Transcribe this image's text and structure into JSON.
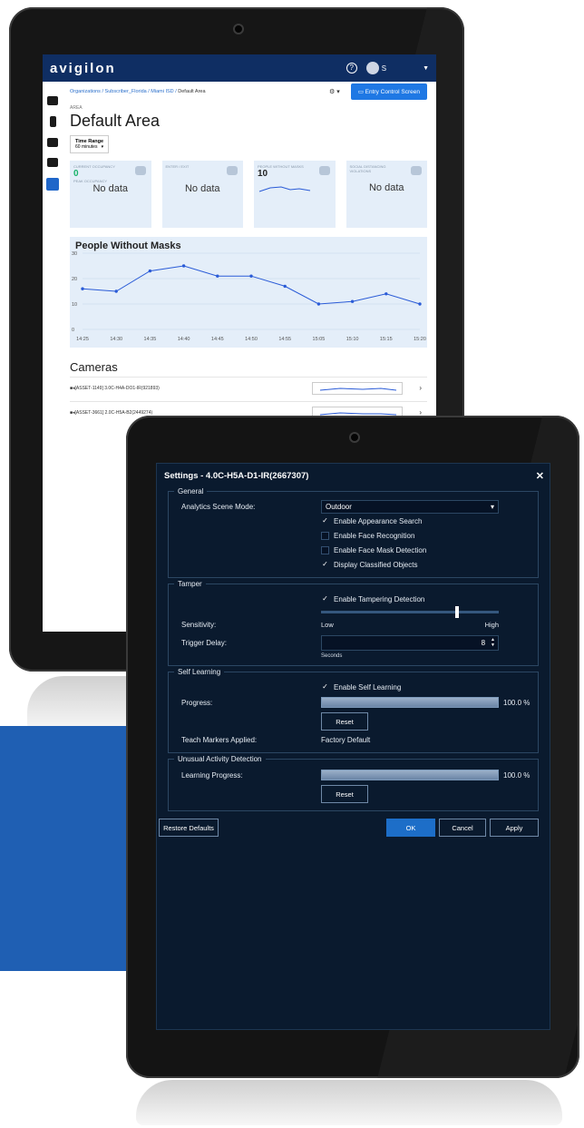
{
  "back_app": {
    "logo": "avigilon",
    "user_initial": "S",
    "breadcrumb": {
      "org": "Organizations",
      "sub": "Subscriber_Florida",
      "site": "Miami ISD",
      "current": "Default Area",
      "sep": "/"
    },
    "entry_button": "Entry Control Screen",
    "area_label": "AREA",
    "title": "Default Area",
    "time_range": {
      "label": "Time Range",
      "value": "60 minutes"
    },
    "cards": {
      "occupancy": {
        "label": "CURRENT OCCUPANCY",
        "value": "0",
        "peak_label": "PEAK OCCUPANCY",
        "peak_value": "No data"
      },
      "enter_exit": {
        "label": "ENTER / EXIT",
        "value": "No data"
      },
      "no_masks": {
        "label": "PEOPLE WITHOUT MASKS",
        "value": "10"
      },
      "social": {
        "label": "SOCIAL DISTANCING VIOLATIONS",
        "value": "No data"
      }
    },
    "cameras_title": "Cameras",
    "cameras": [
      {
        "name": "[ASSET-1149] 3.0C-H4A-DO1-IR(921893)"
      },
      {
        "name": "[ASSET-3661] 2.0C-H5A-B2(2449274)"
      }
    ]
  },
  "chart_data": {
    "type": "line",
    "title": "People Without Masks",
    "categories": [
      "14:25",
      "14:30",
      "14:35",
      "14:40",
      "14:45",
      "14:50",
      "14:55",
      "15:05",
      "15:10",
      "15:15",
      "15:20"
    ],
    "series": [
      {
        "values": [
          16,
          15,
          23,
          25,
          21,
          21,
          17,
          10,
          11,
          14,
          10
        ]
      }
    ],
    "ylim": [
      0,
      30
    ],
    "yticks": [
      "0",
      "10",
      "20",
      "30"
    ],
    "grid": true,
    "color": "#2a5bd7"
  },
  "dialog": {
    "title": "Settings - 4.0C-H5A-D1-IR(2667307)",
    "general": {
      "legend": "General",
      "scene_label": "Analytics Scene Mode:",
      "scene_value": "Outdoor",
      "checks": [
        {
          "label": "Enable Appearance Search",
          "checked": true
        },
        {
          "label": "Enable Face Recognition",
          "checked": false
        },
        {
          "label": "Enable Face Mask Detection",
          "checked": false
        },
        {
          "label": "Display Classified Objects",
          "checked": true
        }
      ]
    },
    "tamper": {
      "legend": "Tamper",
      "enable_label": "Enable Tampering Detection",
      "sensitivity_label": "Sensitivity:",
      "sensitivity_level": 0.77,
      "low": "Low",
      "high": "High",
      "delay_label": "Trigger Delay:",
      "delay_value": "8",
      "delay_unit": "Seconds"
    },
    "self_learning": {
      "legend": "Self Learning",
      "enable_label": "Enable Self Learning",
      "progress_label": "Progress:",
      "progress_value": "100.0 %",
      "reset": "Reset",
      "teach_label": "Teach Markers Applied:",
      "teach_value": "Factory Default"
    },
    "unusual": {
      "legend": "Unusual Activity Detection",
      "progress_label": "Learning Progress:",
      "progress_value": "100.0 %",
      "reset": "Reset"
    },
    "footer": {
      "restore": "Restore Defaults",
      "ok": "OK",
      "cancel": "Cancel",
      "apply": "Apply"
    }
  }
}
